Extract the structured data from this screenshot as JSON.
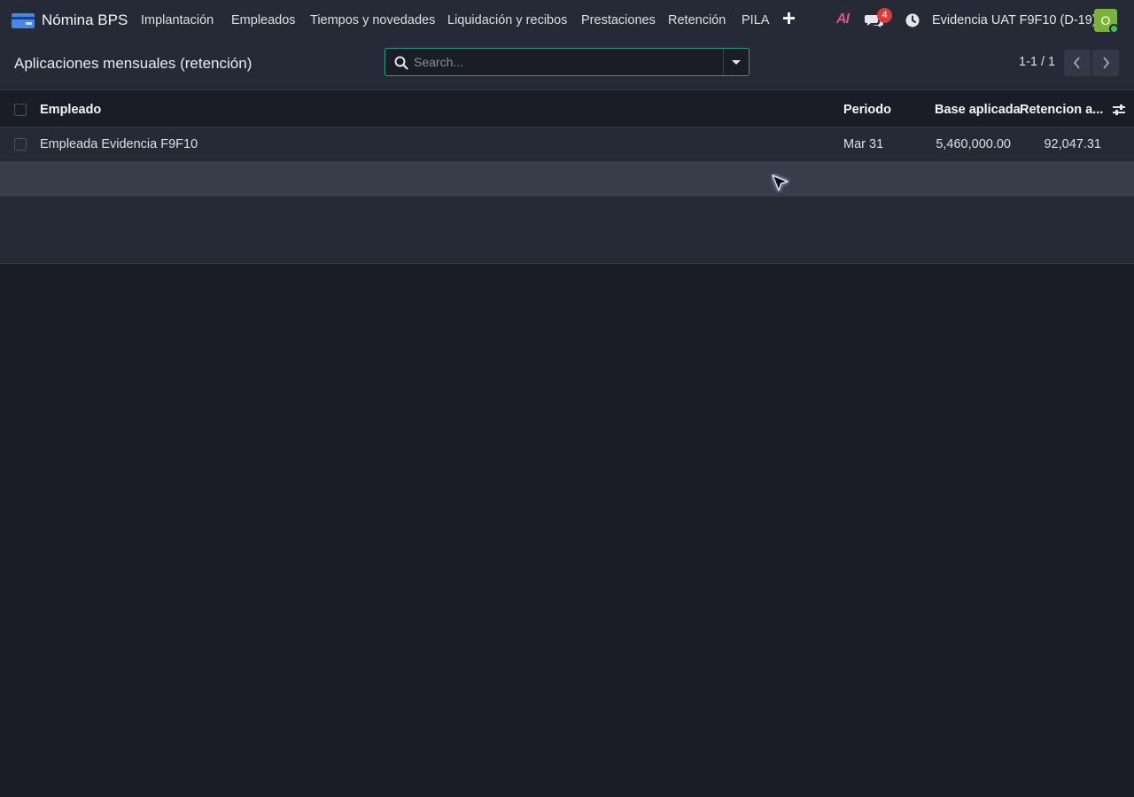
{
  "navbar": {
    "brand": "Nómina BPS",
    "menu": [
      "Implantación",
      "Empleados",
      "Tiempos y novedades",
      "Liquidación y recibos",
      "Prestaciones",
      "Retención",
      "PILA"
    ],
    "chat_badge": "4",
    "company": "Evidencia UAT F9F10 (D-19)",
    "avatar_letter": "O",
    "ai_label": "AI",
    "icons": [
      "app-icon",
      "plus-icon",
      "ai-icon",
      "chat-icon",
      "clock-icon",
      "avatar"
    ]
  },
  "control_panel": {
    "title": "Aplicaciones mensuales (retención)",
    "search": {
      "placeholder": "Search...",
      "value": ""
    },
    "pager": "1-1 / 1"
  },
  "table": {
    "columns": [
      "Empleado",
      "Periodo",
      "Base aplicada",
      "Retencion a..."
    ],
    "rows": [
      {
        "empleado": "Empleada Evidencia F9F10",
        "periodo": "Mar 31",
        "base": "5,460,000.00",
        "retencion": "92,047.31"
      }
    ]
  },
  "colors": {
    "accent": "#2a9d8f",
    "badge": "#d93b3b",
    "avatar": "#7bb33a",
    "background": "#1b1d26",
    "panel": "#262a36"
  }
}
